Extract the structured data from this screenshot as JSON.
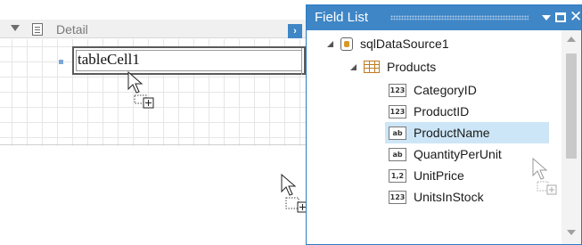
{
  "designer": {
    "band_label": "Detail",
    "table_cell_text": "tableCell1"
  },
  "field_list": {
    "title": "Field List",
    "datasource": "sqlDataSource1",
    "table": "Products",
    "fields": [
      {
        "type_badge": "123",
        "name": "CategoryID"
      },
      {
        "type_badge": "123",
        "name": "ProductID"
      },
      {
        "type_badge": "ab",
        "name": "ProductName",
        "selected": true
      },
      {
        "type_badge": "ab",
        "name": "QuantityPerUnit"
      },
      {
        "type_badge": "1,2",
        "name": "UnitPrice"
      },
      {
        "type_badge": "123",
        "name": "UnitsInStock"
      }
    ]
  },
  "icons": {
    "band_collapse": "triangle-down-icon",
    "band": "band-detail-icon",
    "band_smart_tag": "chevron-right-icon",
    "datasource": "database-icon",
    "table": "table-icon",
    "cursor_drag": "drag-copy-cursor-icon"
  },
  "colors": {
    "accent": "#3f86c6",
    "selection": "#cde6f7"
  }
}
